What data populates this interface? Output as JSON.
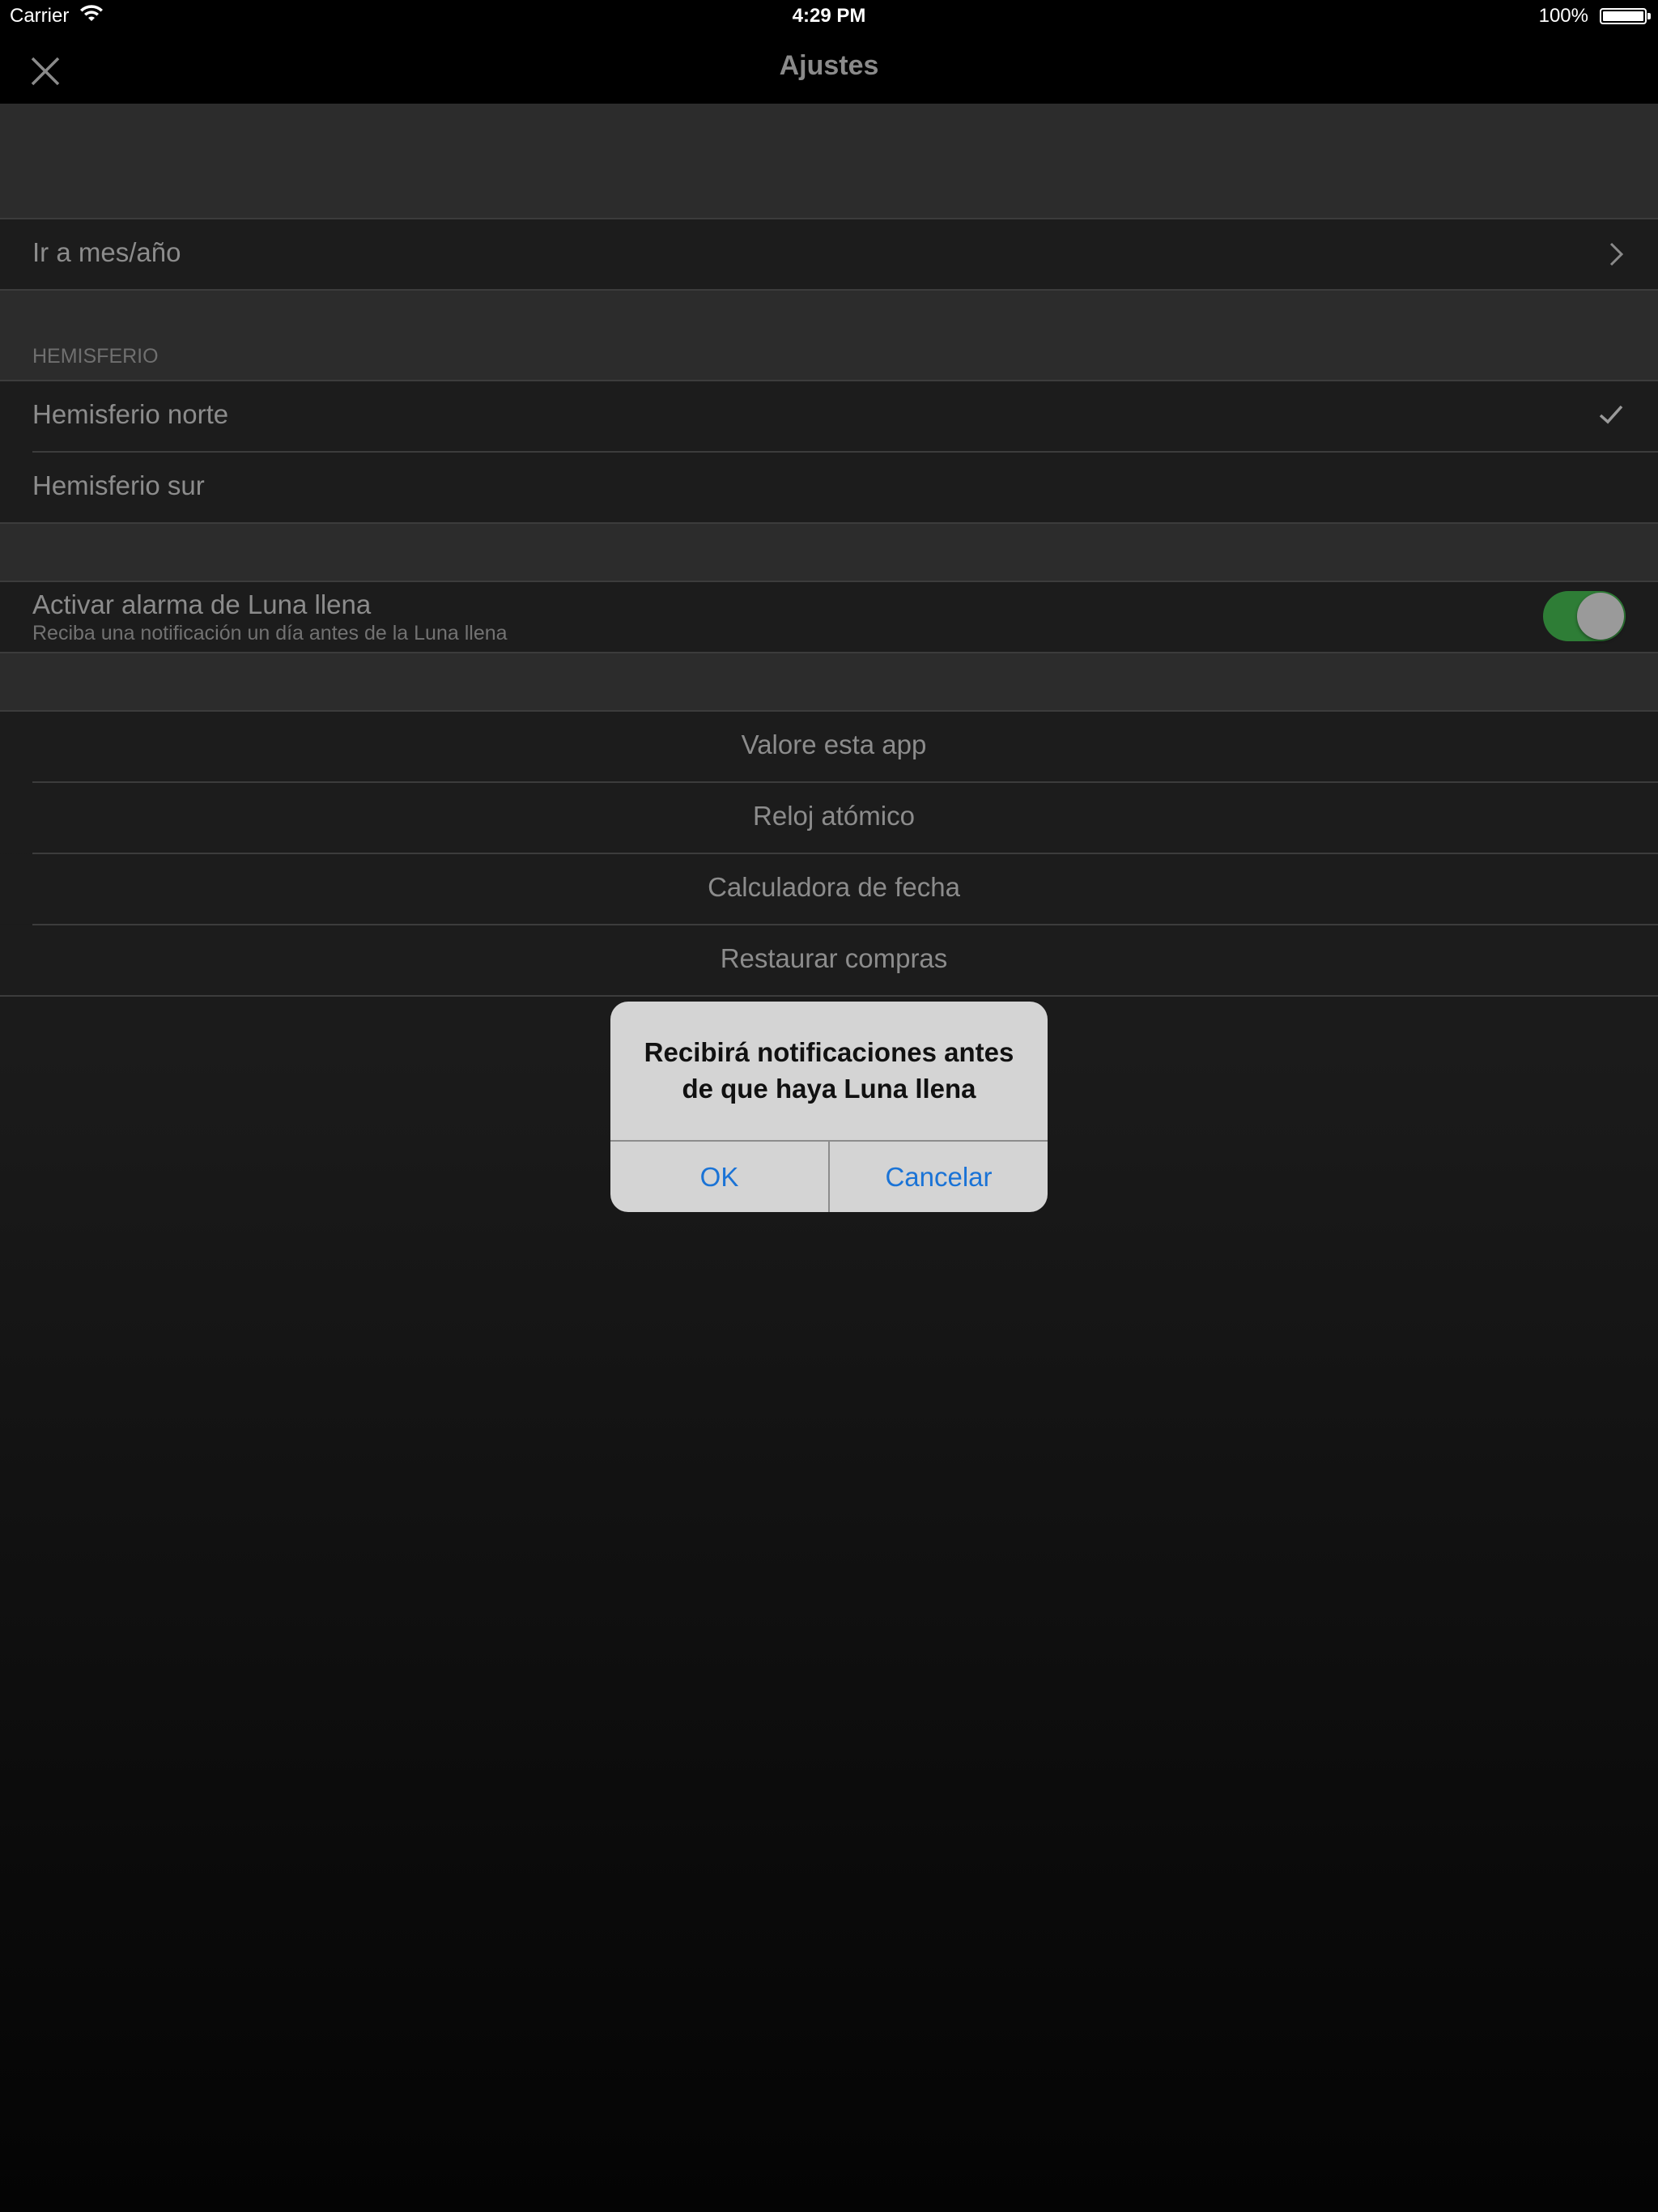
{
  "status_bar": {
    "carrier": "Carrier",
    "time": "4:29 PM",
    "battery": "100%"
  },
  "nav": {
    "title": "Ajustes",
    "close_icon": "close-icon"
  },
  "settings": {
    "goto_label": "Ir a mes/año",
    "hemisphere": {
      "header": "HEMISFERIO",
      "north": "Hemisferio norte",
      "south": "Hemisferio sur",
      "selected": "Hemisferio norte"
    },
    "alarm": {
      "title": "Activar alarma de Luna llena",
      "subtitle": "Reciba una notificación un día antes de la Luna llena",
      "enabled": true
    },
    "actions": [
      "Valore esta app",
      "Reloj atómico",
      "Calculadora de fecha",
      "Restaurar compras"
    ]
  },
  "alert": {
    "line1": "Recibirá notificaciones antes",
    "line2": "de que haya Luna llena",
    "ok": "OK",
    "cancel": "Cancelar"
  },
  "colors": {
    "toggle_on": "#2e7d36",
    "alert_button": "#1a73d6"
  }
}
